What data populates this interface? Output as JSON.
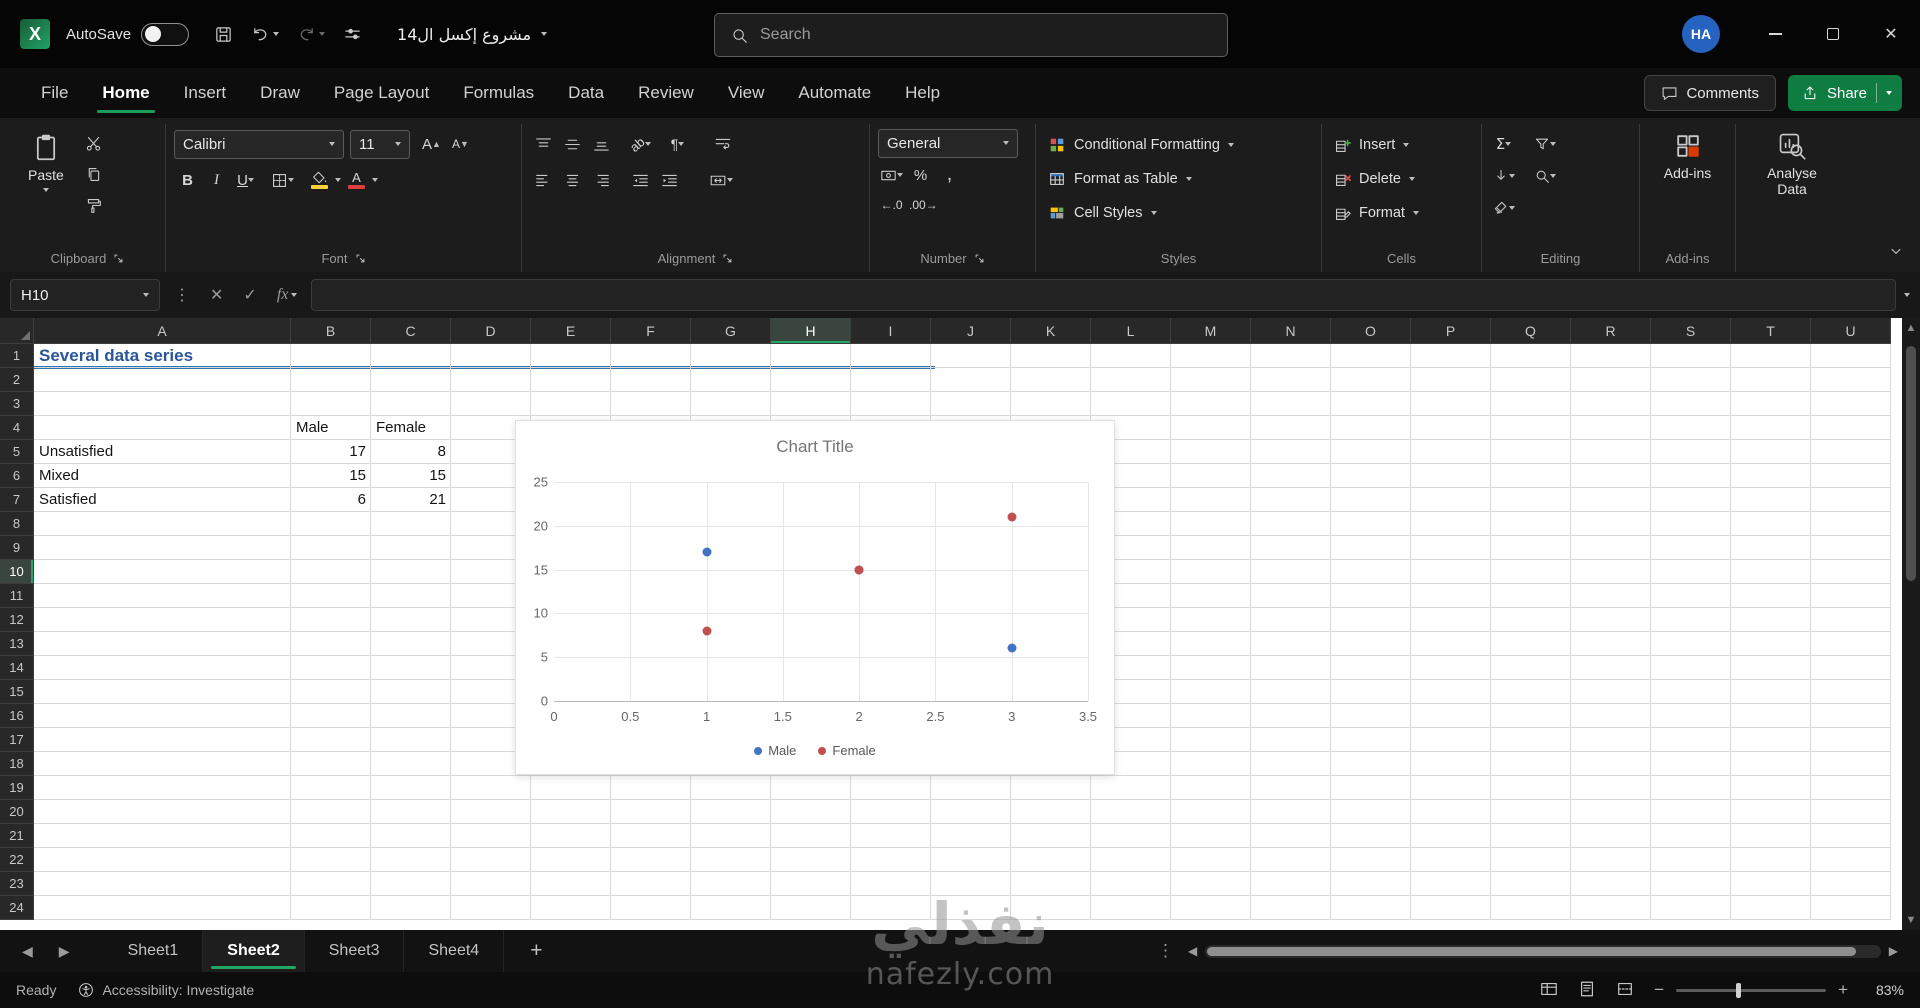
{
  "titlebar": {
    "autosave_label": "AutoSave",
    "filename": "مشروع إكسل ال14",
    "search_placeholder": "Search",
    "avatar_initials": "HA"
  },
  "ribbon": {
    "tabs": [
      {
        "label": "File",
        "active": false
      },
      {
        "label": "Home",
        "active": true
      },
      {
        "label": "Insert",
        "active": false
      },
      {
        "label": "Draw",
        "active": false
      },
      {
        "label": "Page Layout",
        "active": false
      },
      {
        "label": "Formulas",
        "active": false
      },
      {
        "label": "Data",
        "active": false
      },
      {
        "label": "Review",
        "active": false
      },
      {
        "label": "View",
        "active": false
      },
      {
        "label": "Automate",
        "active": false
      },
      {
        "label": "Help",
        "active": false
      }
    ],
    "comments_label": "Comments",
    "share_label": "Share",
    "groups": {
      "clipboard": {
        "label": "Clipboard",
        "paste_label": "Paste"
      },
      "font": {
        "label": "Font",
        "family": "Calibri",
        "size": "11"
      },
      "alignment": {
        "label": "Alignment"
      },
      "number": {
        "label": "Number",
        "format": "General"
      },
      "styles": {
        "label": "Styles",
        "items": [
          "Conditional Formatting",
          "Format as Table",
          "Cell Styles"
        ]
      },
      "cells": {
        "label": "Cells",
        "items": [
          "Insert",
          "Delete",
          "Format"
        ]
      },
      "editing": {
        "label": "Editing"
      },
      "addins": {
        "label": "Add-ins",
        "button_label": "Add-ins"
      },
      "analyse": {
        "button_label": "Analyse Data"
      }
    }
  },
  "formula_bar": {
    "name_box": "H10",
    "formula": ""
  },
  "grid": {
    "columns": [
      "A",
      "B",
      "C",
      "D",
      "E",
      "F",
      "G",
      "H",
      "I",
      "J",
      "K",
      "L",
      "M",
      "N",
      "O",
      "P",
      "Q",
      "R",
      "S",
      "T",
      "U"
    ],
    "row_count": 24,
    "selected_column": "H",
    "selected_row": 10,
    "cells": {
      "A1": "Several data series",
      "B4": "Male",
      "C4": "Female",
      "A5": "Unsatisfied",
      "B5": "17",
      "C5": "8",
      "A6": "Mixed",
      "B6": "15",
      "C6": "15",
      "A7": "Satisfied",
      "B7": "6",
      "C7": "21"
    }
  },
  "chart_data": {
    "type": "scatter",
    "title": "Chart Title",
    "xlabel": "",
    "ylabel": "",
    "xlim": [
      0,
      3.5
    ],
    "ylim": [
      0,
      25
    ],
    "x_ticks": [
      0,
      0.5,
      1,
      1.5,
      2,
      2.5,
      3,
      3.5
    ],
    "y_ticks": [
      0,
      5,
      10,
      15,
      20,
      25
    ],
    "grid": true,
    "legend_position": "bottom",
    "series": [
      {
        "name": "Male",
        "color": "#4472c4",
        "points": [
          [
            1,
            17
          ],
          [
            2,
            15
          ],
          [
            3,
            6
          ]
        ]
      },
      {
        "name": "Female",
        "color": "#c0504d",
        "points": [
          [
            1,
            8
          ],
          [
            2,
            15
          ],
          [
            3,
            21
          ]
        ]
      }
    ]
  },
  "sheet_tabs": {
    "tabs": [
      {
        "label": "Sheet1",
        "active": false
      },
      {
        "label": "Sheet2",
        "active": true
      },
      {
        "label": "Sheet3",
        "active": false
      },
      {
        "label": "Sheet4",
        "active": false
      }
    ]
  },
  "status_bar": {
    "mode": "Ready",
    "accessibility": "Accessibility: Investigate",
    "zoom_level": "83%"
  },
  "watermark": {
    "line1": "نفذلي",
    "line2": "nafezly.com"
  }
}
